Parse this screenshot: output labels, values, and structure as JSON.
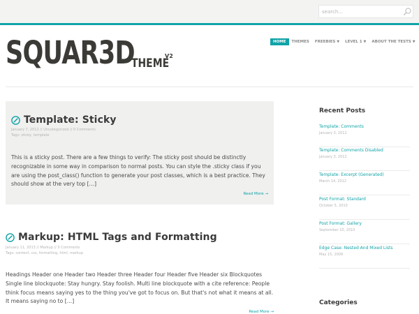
{
  "search": {
    "placeholder": "search..."
  },
  "logo": {
    "main": "SQUAR3D",
    "theme": "THEME",
    "version": "V2"
  },
  "nav": {
    "items": [
      {
        "label": "HOME",
        "active": true,
        "has_dropdown": false
      },
      {
        "label": "THEMES",
        "active": false,
        "has_dropdown": false
      },
      {
        "label": "FREEBIES",
        "active": false,
        "has_dropdown": true
      },
      {
        "label": "LEVEL 1",
        "active": false,
        "has_dropdown": true
      },
      {
        "label": "ABOUT THE TESTS",
        "active": false,
        "has_dropdown": true
      }
    ],
    "caret": "▼"
  },
  "posts": [
    {
      "title": "Template: Sticky",
      "date": "January 7, 2012",
      "separator": "//",
      "category": "Uncategorized",
      "comments": "0 Comments",
      "tags_prefix": "Tags:",
      "tags": "sticky, template",
      "excerpt": "This is a sticky post. There are a few things to verify: The sticky post should be distinctly recognizable in some way in comparison to normal posts. You can style the .sticky class if you are using the post_class() function to generate your post classes, which is a best practice. They should show at the very top […]",
      "read_more": "Read More →",
      "sticky": true
    },
    {
      "title": "Markup: HTML Tags and Formatting",
      "date": "January 11, 2013",
      "separator": "//",
      "category": "Markup",
      "comments": "0 Comments",
      "tags_prefix": "Tags:",
      "tags": "content, css, formatting, html, markup",
      "excerpt": "Headings Header one Header two Header three Header four Header five Header six Blockquotes Single line blockquote: Stay hungry. Stay foolish. Multi line blockquote with a cite reference: People think focus means saying yes to the thing you've got to focus on. But that's not what it means at all. It means saying no to […]",
      "read_more": "Read More →",
      "sticky": false
    }
  ],
  "sidebar": {
    "recent_posts_title": "Recent Posts",
    "recent_posts": [
      {
        "title": "Template: Comments",
        "date": "January 3, 2012"
      },
      {
        "title": "Template: Comments Disabled",
        "date": "January 3, 2012"
      },
      {
        "title": "Template: Excerpt (Generated)",
        "date": "March 14, 2012"
      },
      {
        "title": "Post Format: Standard",
        "date": "October 5, 2010"
      },
      {
        "title": "Post Format: Gallery",
        "date": "September 10, 2010"
      },
      {
        "title": "Edge Case: Nested And Mixed Lists",
        "date": "May 15, 2009"
      }
    ],
    "categories_title": "Categories"
  },
  "colors": {
    "accent": "#10a3a8",
    "topbar_bg": "#f3f3f2",
    "sticky_bg": "#f0f0ef",
    "logo_text": "#3b3a36",
    "meta_text": "#b4b4b4"
  },
  "icons": {
    "search": "magnifier-icon",
    "post_format": "compass-pencil-icon"
  }
}
